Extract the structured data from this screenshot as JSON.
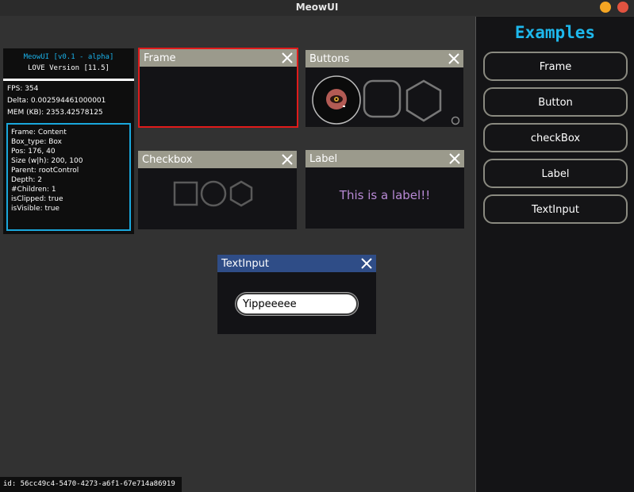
{
  "app": {
    "title": "MeowUI"
  },
  "debug": {
    "version_line": "MeowUI [v0.1 - alpha]",
    "love_version": "LOVE Version [11.5]",
    "fps": "FPS: 354",
    "delta": "Delta: 0.002594461000001",
    "mem": "MEM (KB): 2353.42578125",
    "info": [
      "Frame: Content",
      "Box_type: Box",
      "Pos: 176, 40",
      "Size (w|h): 200, 100",
      "Parent: rootControl",
      "Depth: 2",
      "#Children: 1",
      "isClipped: true",
      "isVisible: true"
    ]
  },
  "windows": {
    "frame": {
      "title": "Frame"
    },
    "buttons": {
      "title": "Buttons"
    },
    "checkbox": {
      "title": "Checkbox"
    },
    "label": {
      "title": "Label",
      "text": "This is a label!!"
    },
    "textinput": {
      "title": "TextInput",
      "value": "Yippeeeee"
    }
  },
  "sidebar": {
    "heading": "Examples",
    "items": [
      {
        "label": "Frame"
      },
      {
        "label": "Button"
      },
      {
        "label": "checkBox"
      },
      {
        "label": "Label"
      },
      {
        "label": "TextInput"
      }
    ]
  },
  "status": {
    "id_text": "id: 56cc49c4-5470-4273-a6f1-67e714a86919"
  },
  "colors": {
    "background": "#323232",
    "panel": "#131316",
    "window_header": "#9b9a8c",
    "textinput_header": "#2f4d87",
    "accent_cyan": "#1eb8ec",
    "selected_border": "#e01b1b",
    "label_text": "#b98ad6"
  }
}
